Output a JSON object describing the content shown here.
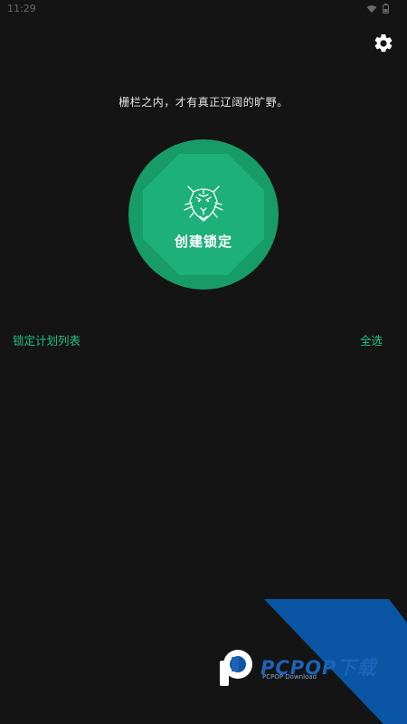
{
  "status": {
    "time": "11:29"
  },
  "tagline": "栅栏之内，才有真正辽阔的旷野。",
  "lock_button": {
    "label": "创建锁定"
  },
  "list": {
    "title": "锁定计划列表",
    "select_all": "全选"
  },
  "watermark": {
    "brand": "PCPOP下载",
    "sub": "PCPOP Download"
  },
  "colors": {
    "background": "#141414",
    "accent": "#22c386",
    "circle": "#179b69",
    "octagon": "#1db07a",
    "watermark_blue": "#0a56a5"
  }
}
